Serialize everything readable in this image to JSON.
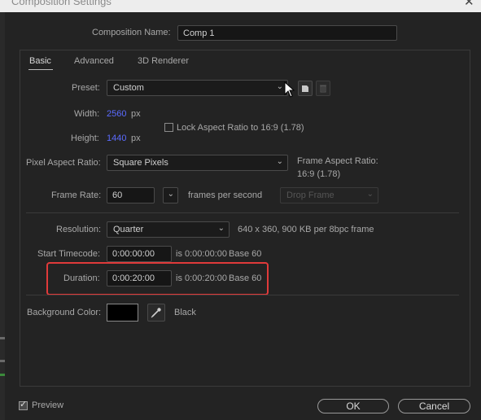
{
  "window": {
    "title": "Composition Settings"
  },
  "comp_name": {
    "label": "Composition Name:",
    "value": "Comp 1"
  },
  "tabs": [
    {
      "label": "Basic"
    },
    {
      "label": "Advanced"
    },
    {
      "label": "3D Renderer"
    }
  ],
  "preset": {
    "label": "Preset:",
    "value": "Custom"
  },
  "width": {
    "label": "Width:",
    "value": "2560",
    "unit": "px"
  },
  "height": {
    "label": "Height:",
    "value": "1440",
    "unit": "px"
  },
  "lock_aspect": {
    "label": "Lock Aspect Ratio to 16:9 (1.78)",
    "checked": false
  },
  "pixel_aspect": {
    "label": "Pixel Aspect Ratio:",
    "value": "Square Pixels"
  },
  "frame_aspect": {
    "label": "Frame Aspect Ratio:",
    "value": "16:9 (1.78)"
  },
  "frame_rate": {
    "label": "Frame Rate:",
    "value": "60",
    "unit": "frames per second",
    "drop_frame": "Drop Frame"
  },
  "resolution": {
    "label": "Resolution:",
    "value": "Quarter",
    "info": "640 x 360, 900 KB per 8bpc frame"
  },
  "start_timecode": {
    "label": "Start Timecode:",
    "value": "0:00:00:00",
    "is_text": "is 0:00:00:00",
    "base": "Base 60"
  },
  "duration": {
    "label": "Duration:",
    "value": "0:00:20:00",
    "is_text": "is 0:00:20:00",
    "base": "Base 60"
  },
  "background": {
    "label": "Background Color:",
    "color_name": "Black",
    "color": "#000000"
  },
  "footer": {
    "preview_label": "Preview",
    "preview_checked": true,
    "ok_label": "OK",
    "cancel_label": "Cancel"
  },
  "colors": {
    "accent_blue": "#5b6bff",
    "highlight_red": "#e03a3a"
  }
}
